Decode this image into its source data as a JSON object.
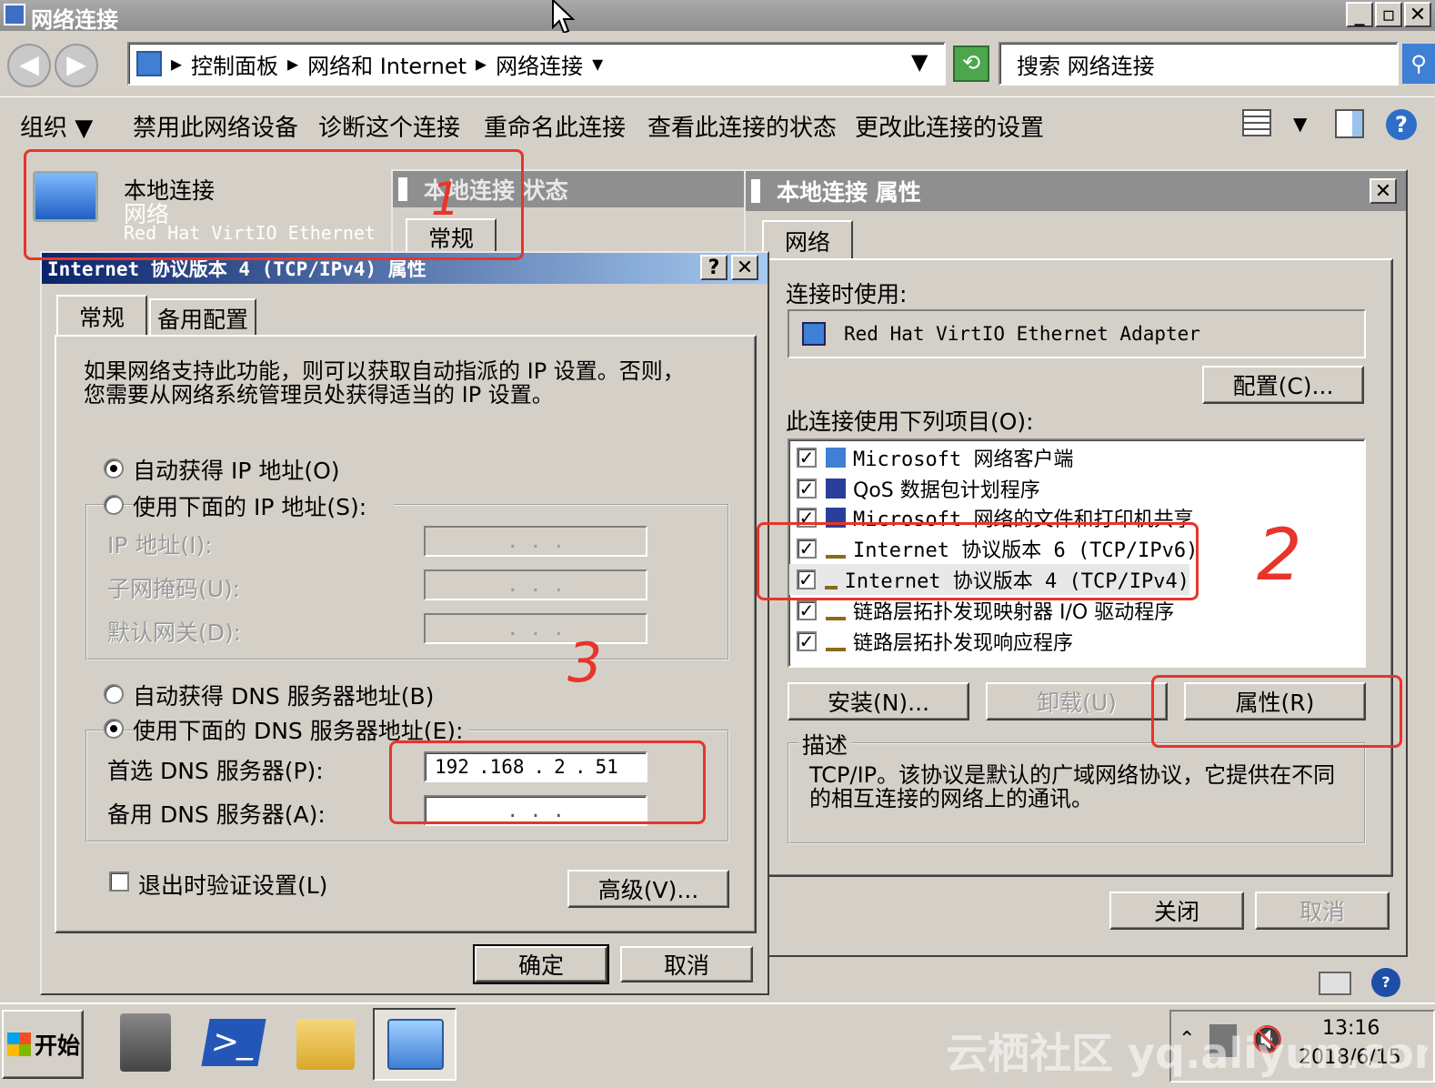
{
  "window": {
    "title": "网络连接"
  },
  "address": {
    "crumbs": [
      "控制面板",
      "网络和 Internet",
      "网络连接"
    ],
    "search_placeholder": "搜索 网络连接"
  },
  "toolbar": {
    "organize": "组织",
    "items": [
      "禁用此网络设备",
      "诊断这个连接",
      "重命名此连接",
      "查看此连接的状态",
      "更改此连接的设置"
    ]
  },
  "connection": {
    "name": "本地连接",
    "type": "网络",
    "adapter": "Red Hat VirtIO Ethernet ..."
  },
  "status_dialog": {
    "title": "本地连接 状态",
    "tab": "常规"
  },
  "ipv4_dialog": {
    "title": "Internet 协议版本 4 (TCP/IPv4) 属性",
    "tabs": [
      "常规",
      "备用配置"
    ],
    "intro": [
      "如果网络支持此功能，则可以获取自动指派的 IP 设置。否则，",
      "您需要从网络系统管理员处获得适当的 IP 设置。"
    ],
    "auto_ip": "自动获得 IP 地址(O)",
    "manual_ip": "使用下面的 IP 地址(S):",
    "ip_label": "IP 地址(I):",
    "mask_label": "子网掩码(U):",
    "gateway_label": "默认网关(D):",
    "auto_dns": "自动获得 DNS 服务器地址(B)",
    "manual_dns": "使用下面的 DNS 服务器地址(E):",
    "pref_dns_label": "首选 DNS 服务器(P):",
    "pref_dns": [
      "192",
      ".168",
      ".",
      "2",
      ".",
      "51"
    ],
    "alt_dns_label": "备用 DNS 服务器(A):",
    "validate": "退出时验证设置(L)",
    "advanced": "高级(V)...",
    "ok": "确定",
    "cancel": "取消"
  },
  "props_dialog": {
    "title": "本地连接 属性",
    "tab": "网络",
    "connect_using": "连接时使用:",
    "adapter": "Red Hat VirtIO Ethernet Adapter",
    "configure": "配置(C)...",
    "items_label": "此连接使用下列项目(O):",
    "items": [
      "Microsoft 网络客户端",
      "QoS 数据包计划程序",
      "Microsoft 网络的文件和打印机共享",
      "Internet 协议版本 6 (TCP/IPv6)",
      "Internet 协议版本 4 (TCP/IPv4)",
      "链路层拓扑发现映射器 I/O 驱动程序",
      "链路层拓扑发现响应程序"
    ],
    "install": "安装(N)...",
    "uninstall": "卸载(U)",
    "properties": "属性(R)",
    "desc_label": "描述",
    "desc": [
      "TCP/IP。该协议是默认的广域网络协议，它提供在不同",
      "的相互连接的网络上的通讯。"
    ],
    "close": "关闭",
    "cancel": "取消"
  },
  "annotations": [
    "1",
    "2",
    "3"
  ],
  "taskbar": {
    "start": "开始",
    "time": "13:16",
    "date": "2018/6/15"
  },
  "watermark": "云栖社区 yq.aliyun.com"
}
